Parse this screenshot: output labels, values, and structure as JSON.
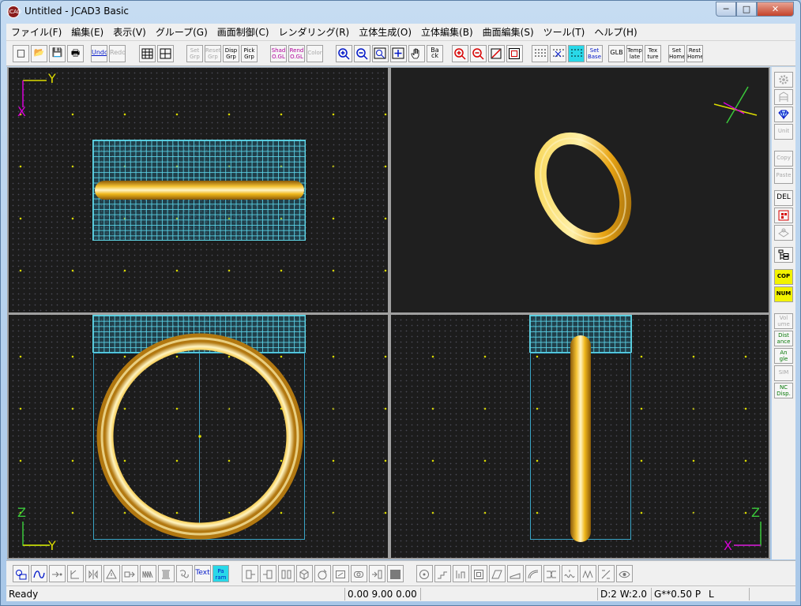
{
  "window": {
    "title": "Untitled - JCAD3 Basic",
    "app_icon": "JCAD"
  },
  "caption": {
    "minimize": "─",
    "maximize": "□",
    "close": "✕"
  },
  "menu": [
    "ファイル(F)",
    "編集(E)",
    "表示(V)",
    "グループ(G)",
    "画面制御(C)",
    "レンダリング(R)",
    "立体生成(O)",
    "立体編集(B)",
    "曲面編集(S)",
    "ツール(T)",
    "ヘルプ(H)"
  ],
  "toolbar": {
    "new": "□",
    "open": "📂",
    "save": "💾",
    "print": "🖶",
    "undo": "Undo",
    "redo": "Redo",
    "set_grp": "Set Grp",
    "reset_grp": "Reset Grp",
    "disp_grp": "Disp Grp",
    "pick_grp": "Pick Grp",
    "shad_ogl": "Shad O.GL",
    "rend_ogl": "Rend O.GL",
    "color": "Color",
    "back": "Ba ck",
    "set_base": "Set Base",
    "glb": "GLB",
    "template": "Temp late",
    "texture": "Tex ture",
    "set_home": "Set Home",
    "rest_home": "Rest Home"
  },
  "viewports": {
    "top": {
      "axis_v": "Y",
      "axis_h": "X"
    },
    "front": {
      "axis_v": "Z",
      "axis_h": "Y"
    },
    "side": {
      "axis_v": "Z",
      "axis_h": "X"
    }
  },
  "right_toolbar": {
    "unit": "Unit",
    "copy": "Copy",
    "paste": "Paste",
    "del": "DEL",
    "cop": "COP",
    "num": "NUM",
    "volume": "Vol ume",
    "distance": "Dist ance",
    "angle": "An gle",
    "sim": "SIM",
    "nc_disp": "NC Disp."
  },
  "bottom_toolbar": {
    "text": "Text",
    "param": "Pa ram"
  },
  "status": {
    "ready": "Ready",
    "coords": "0.00 9.00 0.00",
    "dw": "D:2 W:2.0",
    "grid": "G**0.50 P",
    "mode": "L"
  },
  "colors": {
    "ring_gold": "#f2b81c",
    "viewport_bg": "#1c1c1c",
    "grid_cyan": "#5fd6e6"
  }
}
